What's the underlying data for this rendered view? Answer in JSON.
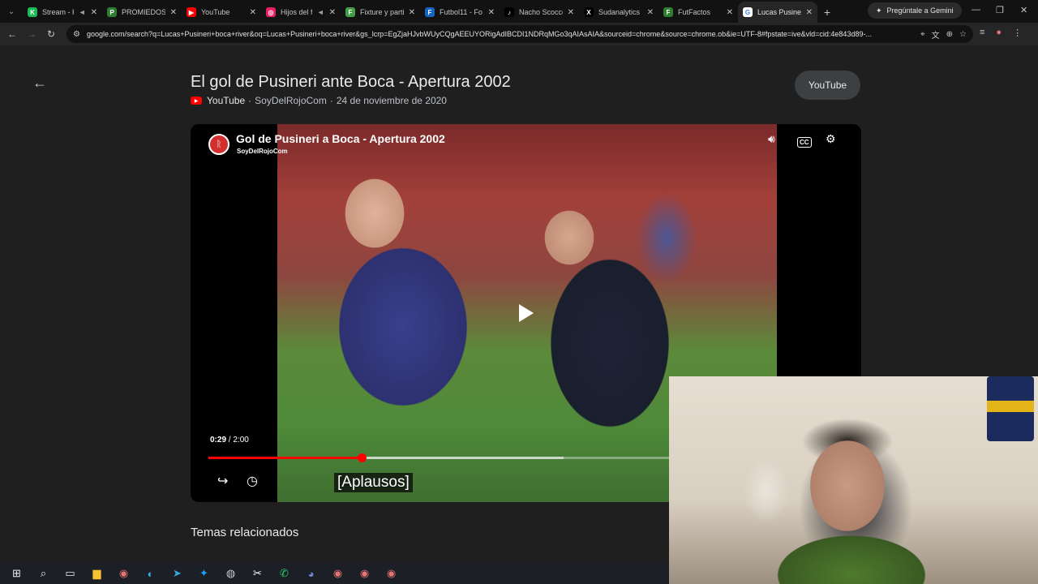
{
  "browser": {
    "tabs": [
      {
        "title": "Stream - K",
        "fav_color": "#1db954",
        "fav_glyph": "K"
      },
      {
        "title": "PROMIEDOS",
        "fav_color": "#2e7d32",
        "fav_glyph": "P"
      },
      {
        "title": "YouTube",
        "fav_color": "#ff0000",
        "fav_glyph": "▶"
      },
      {
        "title": "Hijos del f",
        "fav_color": "#e91e63",
        "fav_glyph": "◎"
      },
      {
        "title": "Fixture y partid",
        "fav_color": "#43a047",
        "fav_glyph": "F"
      },
      {
        "title": "Futbol11 - Fo",
        "fav_color": "#1565c0",
        "fav_glyph": "F"
      },
      {
        "title": "Nacho Scocco",
        "fav_color": "#000000",
        "fav_glyph": "♪"
      },
      {
        "title": "Sudanalytics",
        "fav_color": "#000000",
        "fav_glyph": "X"
      },
      {
        "title": "FutFactos",
        "fav_color": "#2e7d32",
        "fav_glyph": "F"
      },
      {
        "title": "Lucas Pusineri",
        "fav_color": "#ffffff",
        "fav_glyph": "G"
      }
    ],
    "gemini_label": "Pregúntale a Gemini",
    "url": "google.com/search?q=Lucas+Pusineri+boca+river&oq=Lucas+Pusineri+boca+river&gs_lcrp=EgZjaHJvbWUyCQgAEEUYORigAdIBCDI1NDRqMGo3qAIAsAIA&sourceid=chrome&source=chrome.ob&ie=UTF-8#fpstate=ive&vld=cid:4e843d89-..."
  },
  "result": {
    "title": "El gol de Pusineri ante Boca - Apertura 2002",
    "source": "YouTube",
    "channel": "SoyDelRojoCom",
    "date": "24 de noviembre de 2020",
    "chip": "YouTube",
    "separator": "·"
  },
  "video": {
    "title": "Gol de Pusineri a Boca - Apertura 2002",
    "channel": "SoyDelRojoCom",
    "current_time": "0:29",
    "duration": "2:00",
    "time_sep": " / ",
    "progress": 0.2417,
    "buffered": 0.56,
    "caption": "[Aplausos]",
    "cc_label": "CC"
  },
  "related": {
    "heading": "Temas relacionados"
  },
  "taskbar": {
    "icons": [
      "windows-start-icon",
      "search-icon",
      "task-view-icon",
      "file-explorer-icon",
      "chrome-icon",
      "edge-icon",
      "telegram-icon",
      "twitter-icon",
      "obs-icon",
      "capcut-icon",
      "whatsapp-icon",
      "discord-icon",
      "chrome-icon",
      "chrome-icon",
      "chrome-icon"
    ]
  },
  "colors": {
    "accent_red": "#ff0000",
    "page_bg": "#1f1f1f"
  }
}
